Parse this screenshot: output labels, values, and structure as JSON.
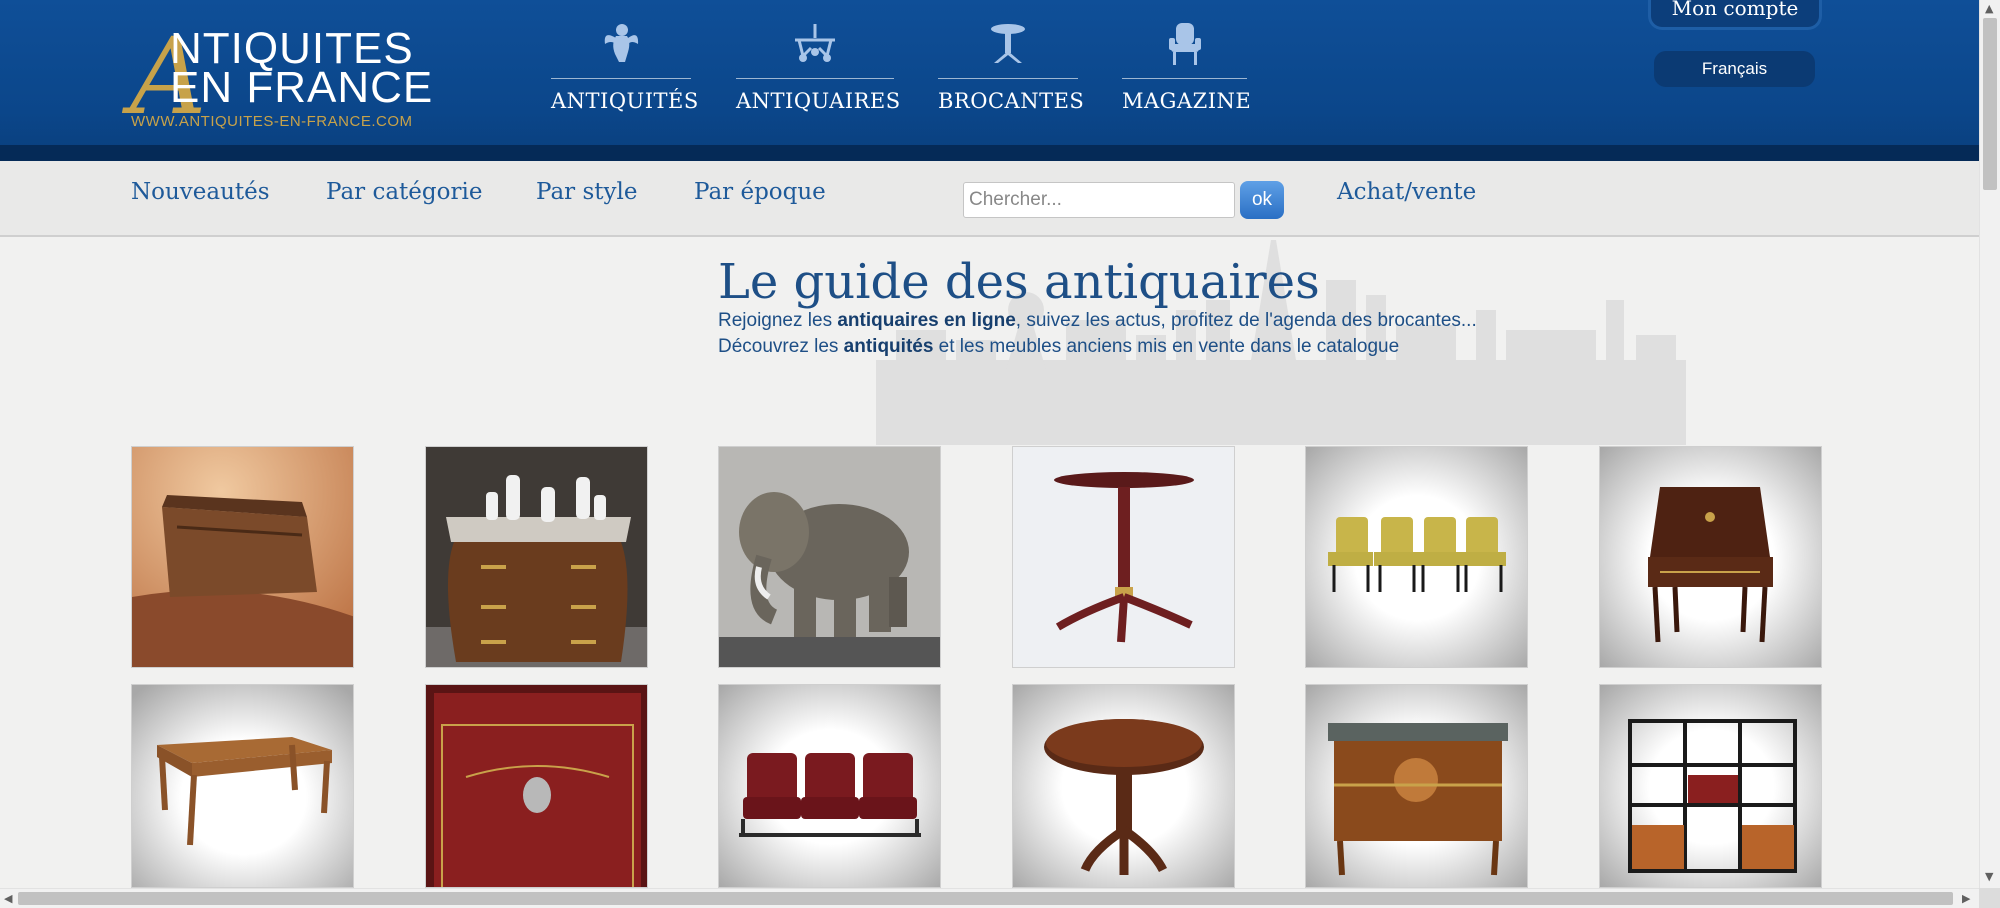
{
  "logo": {
    "big_letter": "A",
    "line1": "NTIQUITES",
    "line2": "EN FRANCE",
    "url": "WWW.ANTIQUITES-EN-FRANCE.COM"
  },
  "main_menu": [
    {
      "label": "ANTIQUITÉS",
      "icon": "cherub-icon"
    },
    {
      "label": "ANTIQUAIRES",
      "icon": "chandelier-icon"
    },
    {
      "label": "BROCANTES",
      "icon": "pedestal-table-icon"
    },
    {
      "label": "MAGAZINE",
      "icon": "armchair-icon"
    }
  ],
  "account": {
    "label": "Mon compte"
  },
  "language": {
    "selected": "Français"
  },
  "subnav": {
    "items": [
      "Nouveautés",
      "Par catégorie",
      "Par style",
      "Par époque"
    ],
    "search_placeholder": "Chercher...",
    "search_button": "ok",
    "achat_vente": "Achat/vente"
  },
  "hero": {
    "title": "Le guide des antiquaires",
    "line1": {
      "pre": "Rejoignez les ",
      "bold": "antiquaires en ligne",
      "post": ", suivez les actus, profitez de l'agenda des brocantes..."
    },
    "line2": {
      "pre": "Découvrez les ",
      "bold": "antiquités",
      "post": " et les meubles anciens mis en vente dans le catalogue"
    }
  },
  "products": [
    {
      "name": "wooden-box"
    },
    {
      "name": "marble-top-commode"
    },
    {
      "name": "ceramic-elephant"
    },
    {
      "name": "pedestal-side-table"
    },
    {
      "name": "set-of-chairs"
    },
    {
      "name": "secretary-desk"
    },
    {
      "name": "farmhouse-table"
    },
    {
      "name": "red-leather-trunk"
    },
    {
      "name": "cinema-seats"
    },
    {
      "name": "round-pedestal-table"
    },
    {
      "name": "marquetry-commode"
    },
    {
      "name": "shelving-unit"
    }
  ],
  "colors": {
    "header_blue": "#0f4f98",
    "gold": "#c7a24a",
    "link_blue": "#1e5a9a",
    "title_blue": "#1e4f86"
  }
}
